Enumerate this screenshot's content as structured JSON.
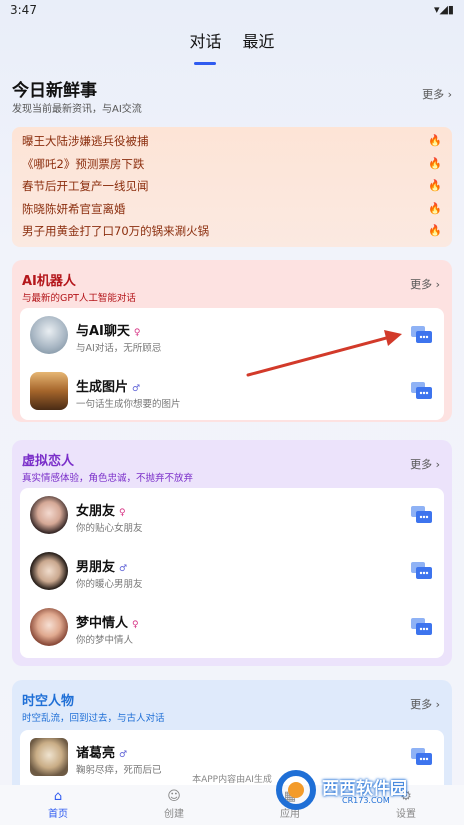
{
  "status": {
    "time": "3:47",
    "icons": "▾◢▮"
  },
  "tabs": [
    {
      "label": "对话",
      "active": true
    },
    {
      "label": "最近",
      "active": false
    }
  ],
  "news": {
    "title": "今日新鲜事",
    "subtitle": "发现当前最新资讯，与AI交流",
    "more": "更多 ›",
    "items": [
      "曝王大陆涉嫌逃兵役被捕",
      "《哪吒2》预测票房下跌",
      "春节后开工复产一线见闻",
      "陈晓陈妍希官宣离婚",
      "男子用黄金打了口70万的锅来涮火锅"
    ]
  },
  "sections": [
    {
      "title": "AI机器人",
      "subtitle": "与最新的GPT人工智能对话",
      "more": "更多 ›",
      "title_color": "#b4161b",
      "sub_color": "#b4161b",
      "bg": "#fde2e1",
      "rows": [
        {
          "name": "与AI聊天",
          "gender": "♀",
          "gclass": "f",
          "desc": "与AI对话，无所顾忌"
        },
        {
          "name": "生成图片",
          "gender": "♂",
          "gclass": "m",
          "desc": "一句话生成你想要的图片"
        }
      ]
    },
    {
      "title": "虚拟恋人",
      "subtitle": "真实情感体验，角色忠诚，不抛弃不放弃",
      "more": "更多 ›",
      "title_color": "#7a2ec9",
      "sub_color": "#7a2ec9",
      "bg": "#ece3fb",
      "rows": [
        {
          "name": "女朋友",
          "gender": "♀",
          "gclass": "f",
          "desc": "你的贴心女朋友"
        },
        {
          "name": "男朋友",
          "gender": "♂",
          "gclass": "m",
          "desc": "你的暖心男朋友"
        },
        {
          "name": "梦中情人",
          "gender": "♀",
          "gclass": "f",
          "desc": "你的梦中情人"
        }
      ]
    },
    {
      "title": "时空人物",
      "subtitle": "时空乱流，回到过去，与古人对话",
      "more": "更多 ›",
      "title_color": "#1f6fd6",
      "sub_color": "#1f6fd6",
      "bg": "#dfeafb",
      "rows": [
        {
          "name": "诸葛亮",
          "gender": "♂",
          "gclass": "m",
          "desc": "鞠躬尽瘁，死而后已"
        }
      ]
    }
  ],
  "footer_note": "本APP内容由AI生成",
  "nav": [
    {
      "label": "首页",
      "icon": "⌂",
      "active": true
    },
    {
      "label": "创建",
      "icon": "☺",
      "active": false
    },
    {
      "label": "应用",
      "icon": "▦",
      "active": false
    },
    {
      "label": "设置",
      "icon": "⚙",
      "active": false
    }
  ],
  "watermark": {
    "text": "西西软件园",
    "url": "CR173.COM"
  }
}
